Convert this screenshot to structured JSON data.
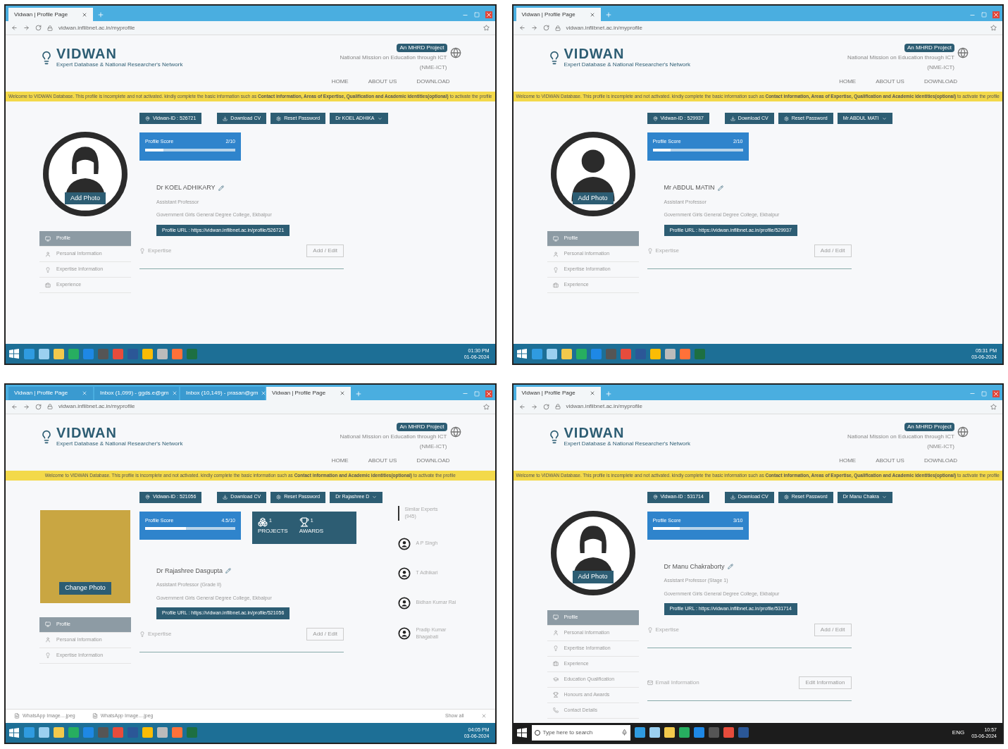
{
  "panels": [
    {
      "browser": {
        "tabs": [
          {
            "label": "Vidwan | Profile Page",
            "selected": true
          }
        ],
        "url": "vidwan.inflibnet.ac.in/myprofile"
      },
      "site": {
        "logo": "VIDWAN",
        "tagline": "Expert Database & National Researcher's Network",
        "badge": "An MHRD Project",
        "mission": "National Mission on Education through ICT",
        "mission_sub": "(NME-ICT)",
        "nav": [
          "HOME",
          "ABOUT US",
          "DOWNLOAD"
        ]
      },
      "banner": "Welcome to VIDWAN Database. This profile is incomplete and not activated. kindly complete the basic information such as **Contact information, Areas of Expertise, Qualification and Academic identities(optional)** to activate the profile",
      "actions": {
        "id": "Vidwan-ID : 526721",
        "download": "Download CV",
        "reset": "Reset Password",
        "user": "Dr KOEL ADHIKA"
      },
      "score": {
        "label": "Profile Score",
        "value": "2/10",
        "level": 0.2
      },
      "photo": {
        "kind": "female",
        "button": "Add Photo"
      },
      "profile": {
        "name": "Dr KOEL ADHIKARY",
        "designation": "Assistant Professor",
        "institution": "Government Girls General Degree College, Ekbalpur",
        "url": "Profile URL : https://vidwan.inflibnet.ac.in/profile/526721"
      },
      "sidebar": [
        {
          "label": "Profile",
          "selected": true
        },
        {
          "label": "Personal Information",
          "selected": false
        },
        {
          "label": "Expertise Information",
          "selected": false
        },
        {
          "label": "Experience",
          "selected": false
        }
      ],
      "sections": [
        {
          "title": "Expertise",
          "action": "Add / Edit"
        }
      ],
      "taskbar": {
        "kind": "win8",
        "time": "01:30 PM",
        "date": "01-06-2024"
      }
    },
    {
      "browser": {
        "tabs": [
          {
            "label": "Vidwan | Profile Page",
            "selected": true
          }
        ],
        "url": "vidwan.inflibnet.ac.in/myprofile"
      },
      "site": {
        "logo": "VIDWAN",
        "tagline": "Expert Database & National Researcher's Network",
        "badge": "An MHRD Project",
        "mission": "National Mission on Education through ICT",
        "mission_sub": "(NME-ICT)",
        "nav": [
          "HOME",
          "ABOUT US",
          "DOWNLOAD"
        ]
      },
      "banner": "Welcome to VIDWAN Database. This profile is incomplete and not activated. kindly complete the basic information such as **Contact information, Areas of Expertise, Qualification and Academic identities(optional)** to activate the profile",
      "actions": {
        "id": "Vidwan-ID : 529937",
        "download": "Download CV",
        "reset": "Reset Password",
        "user": "Mr ABDUL MATI"
      },
      "score": {
        "label": "Profile Score",
        "value": "2/10",
        "level": 0.2
      },
      "photo": {
        "kind": "male",
        "button": "Add Photo"
      },
      "profile": {
        "name": "Mr ABDUL MATIN",
        "designation": "Assistant Professor",
        "institution": "Government Girls General Degree College, Ekbalpur",
        "url": "Profile URL : https://vidwan.inflibnet.ac.in/profile/529937"
      },
      "sidebar": [
        {
          "label": "Profile",
          "selected": true
        },
        {
          "label": "Personal Information",
          "selected": false
        },
        {
          "label": "Expertise Information",
          "selected": false
        },
        {
          "label": "Experience",
          "selected": false
        }
      ],
      "sections": [
        {
          "title": "Expertise",
          "action": "Add / Edit"
        }
      ],
      "taskbar": {
        "kind": "win8",
        "time": "05:31 PM",
        "date": "03-06-2024"
      }
    },
    {
      "browser": {
        "tabs": [
          {
            "label": "Vidwan | Profile Page",
            "selected": false
          },
          {
            "label": "Inbox (1,099) - ggds.e@gm",
            "selected": false
          },
          {
            "label": "Inbox (10,149) - prasan@gm",
            "selected": false
          },
          {
            "label": "Vidwan | Profile Page",
            "selected": true
          }
        ],
        "url": "vidwan.inflibnet.ac.in/myprofile"
      },
      "site": {
        "logo": "VIDWAN",
        "tagline": "Expert Database & National Researcher's Network",
        "badge": "An MHRD Project",
        "mission": "National Mission on Education through ICT",
        "mission_sub": "(NME-ICT)",
        "nav": [
          "HOME",
          "ABOUT US",
          "DOWNLOAD"
        ]
      },
      "banner": "Welcome to VIDWAN Database. This profile is incomplete and not activated. kindly complete the basic information such as **Contact information and Academic identities(optional)** to activate the profile",
      "actions": {
        "id": "Vidwan-ID : 521056",
        "download": "Download CV",
        "reset": "Reset Password",
        "user": "Dr Rajashree D"
      },
      "score": {
        "label": "Profile Score",
        "value": "4.5/10",
        "level": 0.45
      },
      "stats": [
        {
          "count": "1",
          "label": "PROJECTS"
        },
        {
          "count": "1",
          "label": "AWARDS"
        }
      ],
      "photo": {
        "kind": "photo",
        "button": "Change Photo"
      },
      "profile": {
        "name": "Dr Rajashree Dasgupta",
        "designation": "Assistant Professor (Grade II)",
        "institution": "Government Girls General Degree College, Ekbalpur",
        "url": "Profile URL : https://vidwan.inflibnet.ac.in/profile/521056"
      },
      "sidebar": [
        {
          "label": "Profile",
          "selected": true
        },
        {
          "label": "Personal Information",
          "selected": false
        },
        {
          "label": "Expertise Information",
          "selected": false
        }
      ],
      "sections": [
        {
          "title": "Expertise",
          "action": "Add / Edit"
        }
      ],
      "similar": {
        "title": "Similar Experts",
        "count": "(945)",
        "experts": [
          "A P Singh",
          "T Adhikari",
          "Bidhan Kumar Rai",
          "Pradip Kumar Bhagabati"
        ]
      },
      "downloads": {
        "files": [
          "WhatsApp Image....jpeg",
          "WhatsApp Image....jpeg"
        ],
        "show_all": "Show all"
      },
      "taskbar": {
        "kind": "win8",
        "time": "04:05 PM",
        "date": "03-06-2024"
      }
    },
    {
      "browser": {
        "tabs": [
          {
            "label": "Vidwan | Profile Page",
            "selected": true
          }
        ],
        "url": "vidwan.inflibnet.ac.in/myprofile"
      },
      "site": {
        "logo": "VIDWAN",
        "tagline": "Expert Database & National Researcher's Network",
        "badge": "An MHRD Project",
        "mission": "National Mission on Education through ICT",
        "mission_sub": "(NME-ICT)",
        "nav": [
          "HOME",
          "ABOUT US",
          "DOWNLOAD"
        ]
      },
      "banner": "Welcome to VIDWAN Database. This profile is incomplete and not activated. kindly complete the basic information such as **Contact information, Areas of Expertise, Qualification and Academic identities(optional)** to activate the profile",
      "actions": {
        "id": "Vidwan-ID : 531714",
        "download": "Download CV",
        "reset": "Reset Password",
        "user": "Dr Manu Chakra"
      },
      "score": {
        "label": "Profile Score",
        "value": "3/10",
        "level": 0.3
      },
      "photo": {
        "kind": "female",
        "button": "Add Photo"
      },
      "profile": {
        "name": "Dr Manu Chakraborty",
        "designation": "Assistant Professor (Stage 1)",
        "institution": "Government Girls General Degree College, Ekbalpur",
        "url": "Profile URL : https://vidwan.inflibnet.ac.in/profile/531714"
      },
      "sidebar": [
        {
          "label": "Profile",
          "selected": true
        },
        {
          "label": "Personal Information",
          "selected": false
        },
        {
          "label": "Expertise Information",
          "selected": false
        },
        {
          "label": "Experience",
          "selected": false
        },
        {
          "label": "Education Qualification",
          "selected": false
        },
        {
          "label": "Honours and Awards",
          "selected": false
        },
        {
          "label": "Contact Details",
          "selected": false
        }
      ],
      "sections": [
        {
          "title": "Expertise",
          "action": "Add / Edit"
        },
        {
          "title": "Email Information",
          "action": "Edit Information"
        }
      ],
      "taskbar": {
        "kind": "win10",
        "search": "Type here to search",
        "lang": "ENG",
        "time": "10:57",
        "date": "03-06-2024"
      }
    }
  ]
}
